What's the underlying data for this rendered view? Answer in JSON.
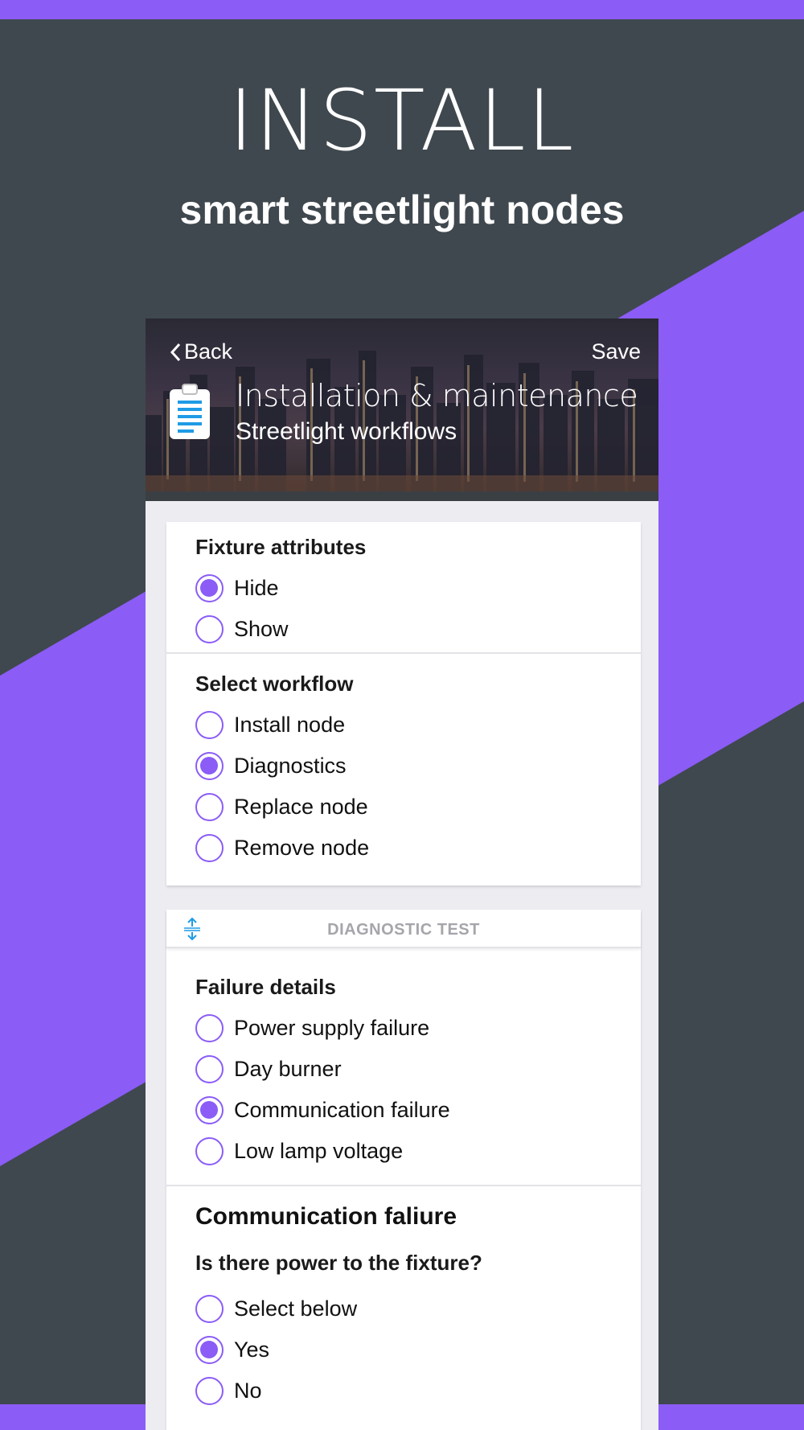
{
  "promo": {
    "headline": "INSTALL",
    "subheadline": "smart streetlight nodes",
    "colors": {
      "background": "#3f484e",
      "accent": "#8b5cf6"
    }
  },
  "app": {
    "header": {
      "back_label": "Back",
      "save_label": "Save",
      "title": "Installation & maintenance",
      "subtitle": "Streetlight workflows",
      "icon": "clipboard-icon"
    },
    "fixture_attributes": {
      "label": "Fixture attributes",
      "options": [
        {
          "label": "Hide",
          "selected": true
        },
        {
          "label": "Show",
          "selected": false
        }
      ]
    },
    "select_workflow": {
      "label": "Select workflow",
      "options": [
        {
          "label": "Install node",
          "selected": false
        },
        {
          "label": "Diagnostics",
          "selected": true
        },
        {
          "label": "Replace node",
          "selected": false
        },
        {
          "label": "Remove node",
          "selected": false
        }
      ]
    },
    "diagnostic_test": {
      "title": "DIAGNOSTIC TEST",
      "icon": "collapse-icon",
      "failure_details": {
        "label": "Failure details",
        "options": [
          {
            "label": "Power supply failure",
            "selected": false
          },
          {
            "label": "Day burner",
            "selected": false
          },
          {
            "label": "Communication failure",
            "selected": true
          },
          {
            "label": "Low lamp voltage",
            "selected": false
          }
        ]
      },
      "communication": {
        "title": "Communication faliure",
        "question": "Is there power to the fixture?",
        "options": [
          {
            "label": "Select below",
            "selected": false
          },
          {
            "label": "Yes",
            "selected": true
          },
          {
            "label": "No",
            "selected": false
          }
        ]
      }
    }
  }
}
